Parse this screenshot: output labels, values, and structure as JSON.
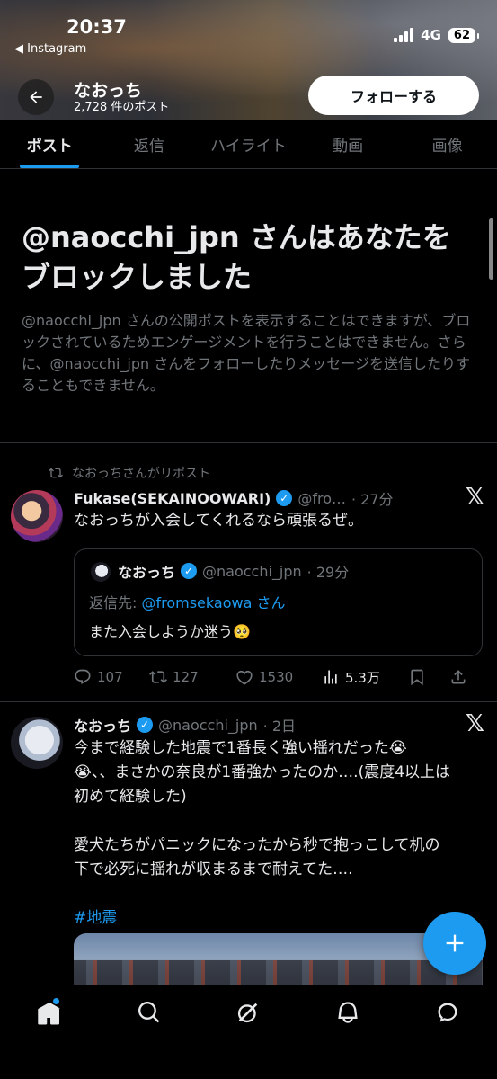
{
  "status_bar": {
    "time": "20:37",
    "back_app": "◀ Instagram",
    "network": "4G",
    "battery": "62"
  },
  "profile": {
    "name": "なおっち",
    "post_count": "2,728 件のポスト",
    "follow_label": "フォローする"
  },
  "tabs": [
    {
      "label": "ポスト",
      "active": true
    },
    {
      "label": "返信"
    },
    {
      "label": "ハイライト"
    },
    {
      "label": "動画"
    },
    {
      "label": "画像"
    }
  ],
  "block_notice": {
    "title": "@naocchi_jpn さんはあなたをブロックしました",
    "description": "@naocchi_jpn さんの公開ポストを表示することはできますが、ブロックされているためエンゲージメントを行うことはできません。さらに、@naocchi_jpn さんをフォローしたりメッセージを送信したりすることもできません。"
  },
  "tweet1": {
    "repost_label": "なおっちさんがリポスト",
    "name": "Fukase(SEKAINOOWARI)",
    "handle": "@fro…",
    "time": "· 27分",
    "text": "なおっちが入会してくれるなら頑張るぜ。",
    "quote": {
      "name": "なおっち",
      "handle": "@naocchi_jpn",
      "time": "· 29分",
      "reply_prefix": "返信先: ",
      "reply_to": "@fromsekaowa さん",
      "text": "また入会しようか迷う🥺"
    },
    "stats": {
      "replies": "107",
      "reposts": "127",
      "likes": "1530",
      "views": "5.3万"
    }
  },
  "tweet2": {
    "name": "なおっち",
    "handle": "@naocchi_jpn",
    "time": "· 2日",
    "text_line1": "今まで経験した地震で1番長く強い揺れだった😭",
    "text_line2": "😭、、まさかの奈良が1番強かったのか….(震度4以上は",
    "text_line3": "初めて経験した)",
    "text_line4": "愛犬たちがパニックになったから秒で抱っこして机の",
    "text_line5": "下で必死に揺れが収まるまで耐えてた….",
    "hashtag": "#地震"
  },
  "colors": {
    "accent": "#1d9bf0",
    "background": "#000000",
    "muted_text": "#71767b",
    "divider": "#2f3336"
  }
}
